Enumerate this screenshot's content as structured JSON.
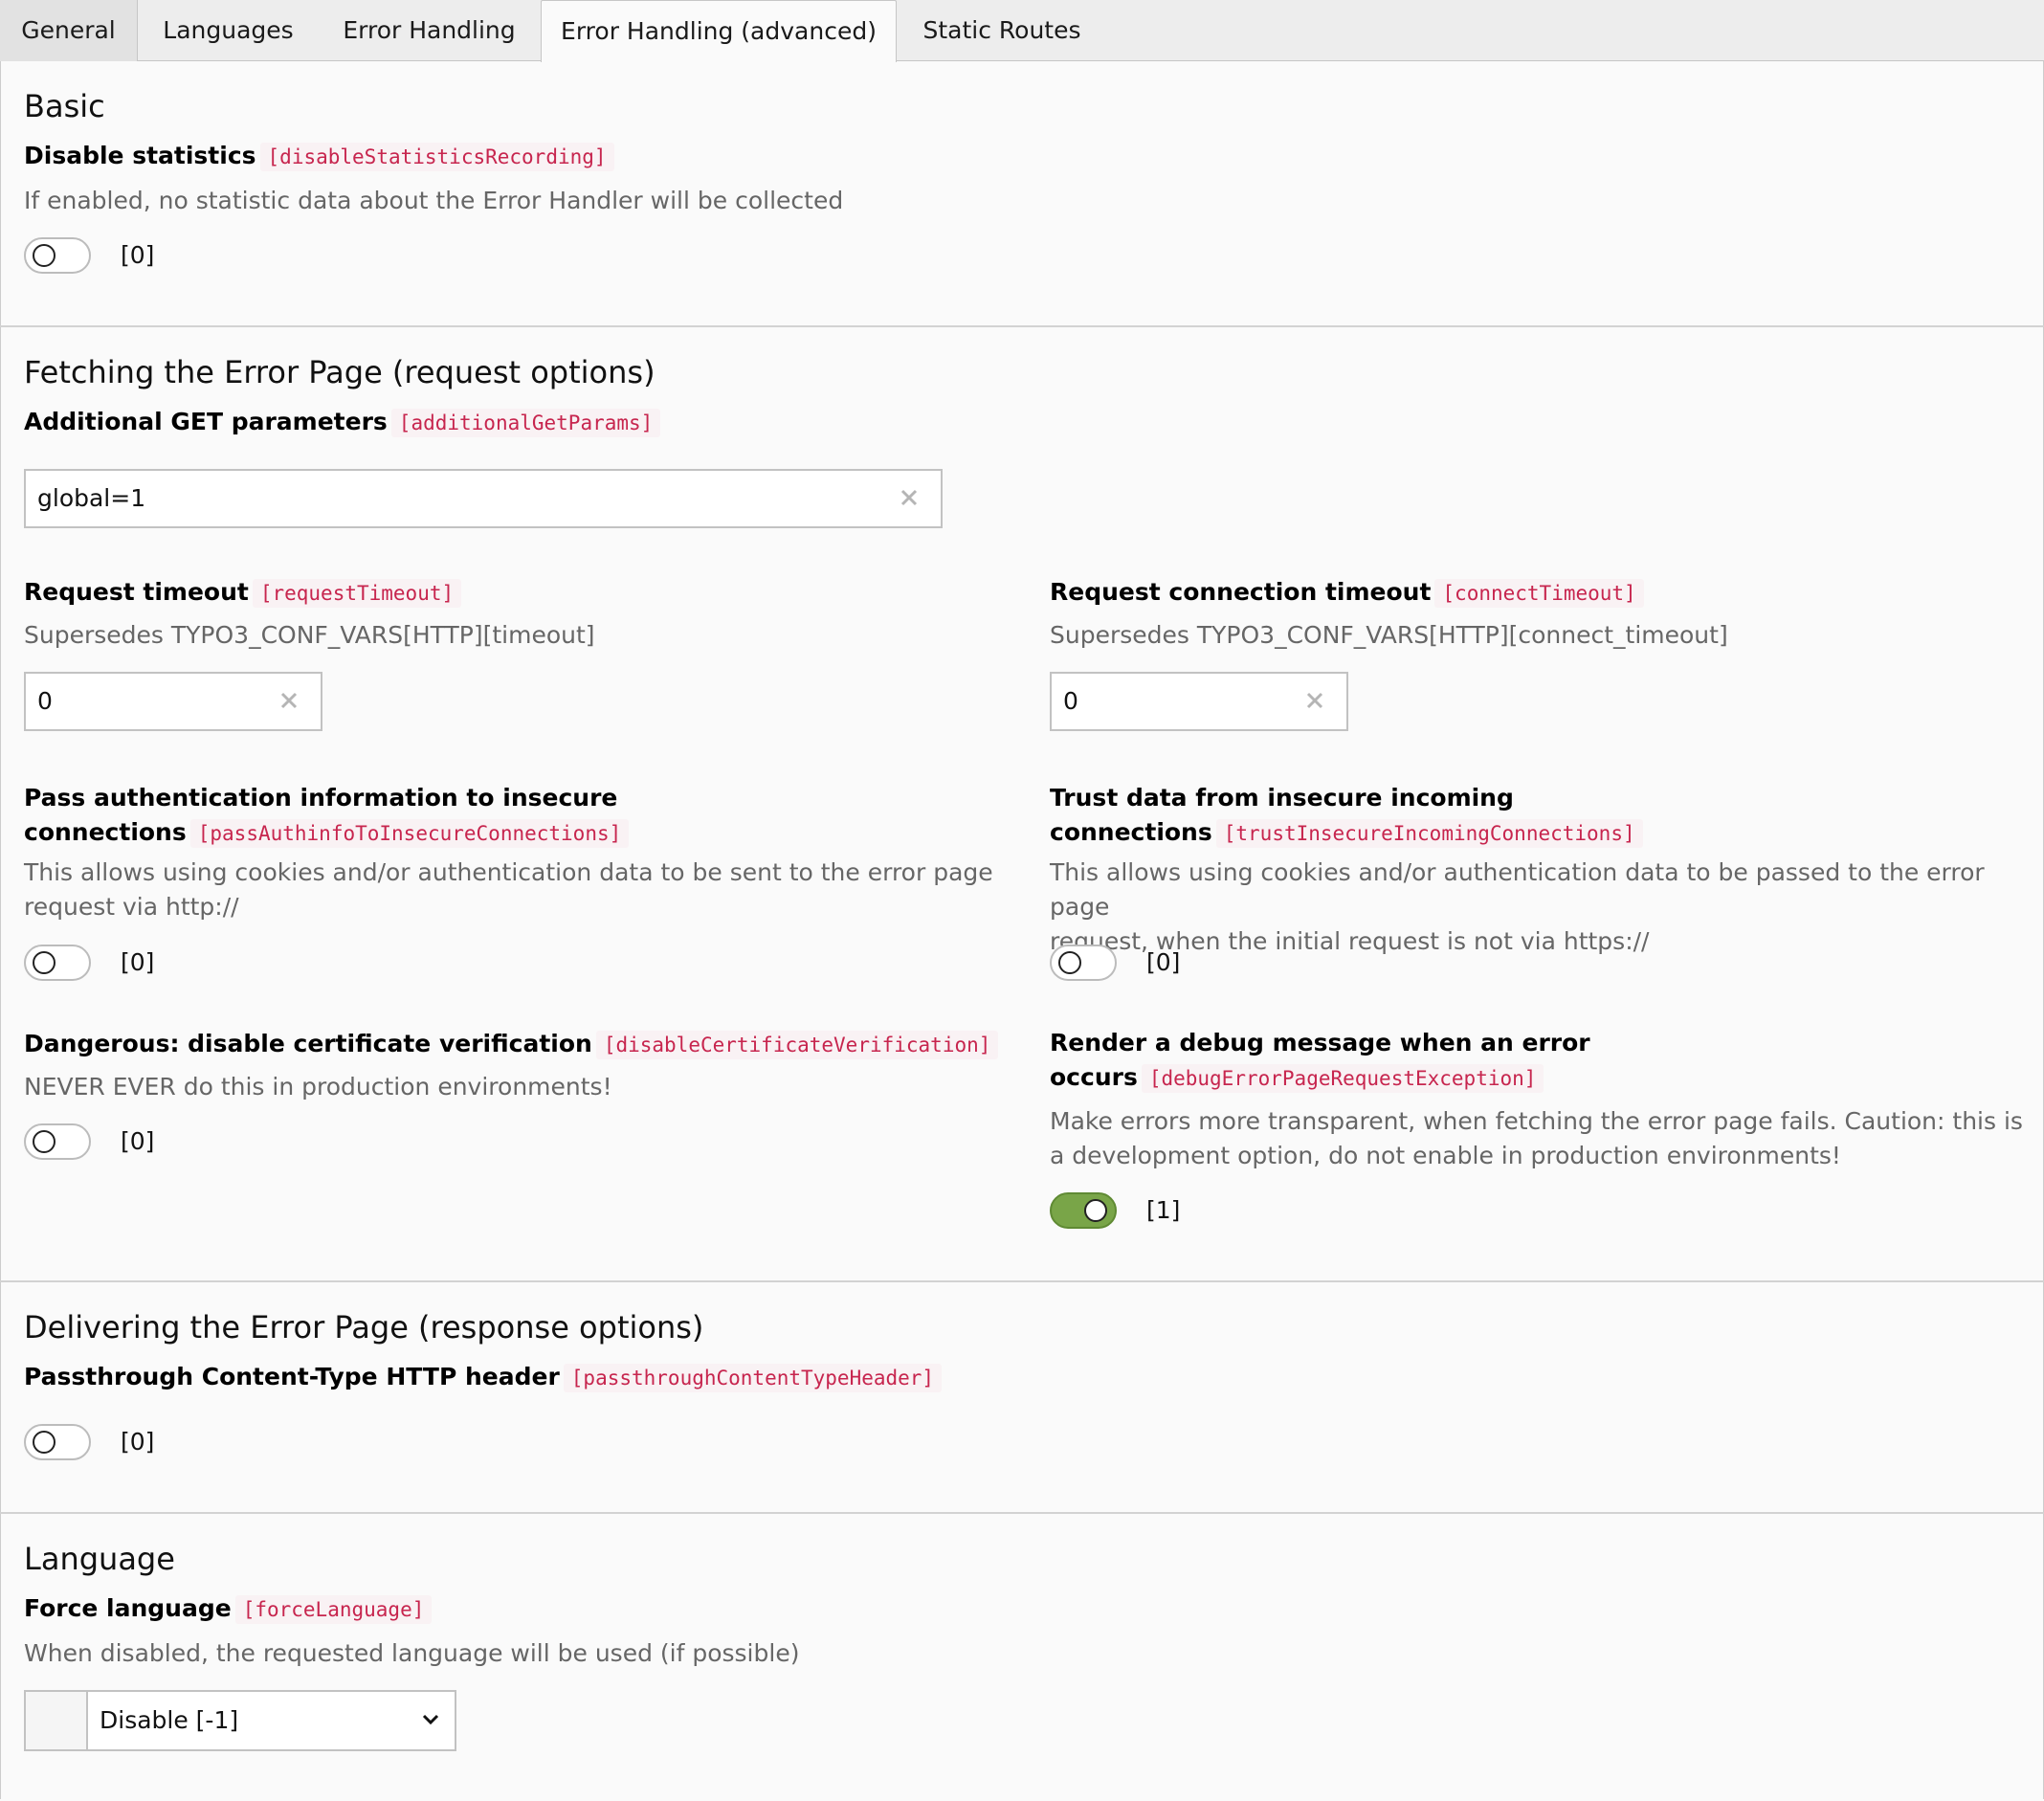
{
  "tabs": [
    {
      "label": "General"
    },
    {
      "label": "Languages"
    },
    {
      "label": "Error Handling"
    },
    {
      "label": "Error Handling (advanced)",
      "active": true
    },
    {
      "label": "Static Routes"
    }
  ],
  "basic": {
    "heading": "Basic",
    "disable_statistics": {
      "label": "Disable statistics",
      "key": "[disableStatisticsRecording]",
      "description": "If enabled, no statistic data about the Error Handler will be collected",
      "value": "[0]",
      "enabled": false
    }
  },
  "fetching": {
    "heading": "Fetching the Error Page (request options)",
    "additional_get": {
      "label": "Additional GET parameters",
      "key": "[additionalGetParams]",
      "value": "global=1"
    },
    "request_timeout": {
      "label": "Request timeout",
      "key": "[requestTimeout]",
      "description": "Supersedes TYPO3_CONF_VARS[HTTP][timeout]",
      "value": "0"
    },
    "connect_timeout": {
      "label": "Request connection timeout",
      "key": "[connectTimeout]",
      "description": "Supersedes TYPO3_CONF_VARS[HTTP][connect_timeout]",
      "value": "0"
    },
    "pass_auth": {
      "label_line1": "Pass authentication information to insecure",
      "label_line2": "connections",
      "key": "[passAuthinfoToInsecureConnections]",
      "description_line1": "This allows using cookies and/or authentication data to be sent to the error page",
      "description_line2": "request via http://",
      "value": "[0]",
      "enabled": false
    },
    "trust_insecure": {
      "label_line1": "Trust data from insecure incoming",
      "label_line2": "connections",
      "key": "[trustInsecureIncomingConnections]",
      "description_line1": "This allows using cookies and/or authentication data to be passed to the error page",
      "description_line2": "request, when the initial request is not via https://",
      "value": "[0]",
      "enabled": false
    },
    "disable_cert": {
      "label": "Dangerous: disable certificate verification",
      "key": "[disableCertificateVerification]",
      "description": "NEVER EVER do this in production environments!",
      "value": "[0]",
      "enabled": false
    },
    "debug_message": {
      "label_line1": "Render a debug message when an error",
      "label_line2": "occurs",
      "key": "[debugErrorPageRequestException]",
      "description_line1": "Make errors more transparent, when fetching the error page fails. Caution: this is",
      "description_line2": "a development option, do not enable in production environments!",
      "value": "[1]",
      "enabled": true
    }
  },
  "delivering": {
    "heading": "Delivering the Error Page (response options)",
    "passthrough": {
      "label": "Passthrough Content-Type HTTP header",
      "key": "[passthroughContentTypeHeader]",
      "value": "[0]",
      "enabled": false
    }
  },
  "language": {
    "heading": "Language",
    "force_language": {
      "label": "Force language",
      "key": "[forceLanguage]",
      "description": "When disabled, the requested language will be used (if possible)",
      "selected": "Disable [-1]"
    }
  },
  "colors": {
    "toggle_on": "#79a548",
    "code_text": "#c7254e",
    "code_bg": "#f9f2f4"
  }
}
